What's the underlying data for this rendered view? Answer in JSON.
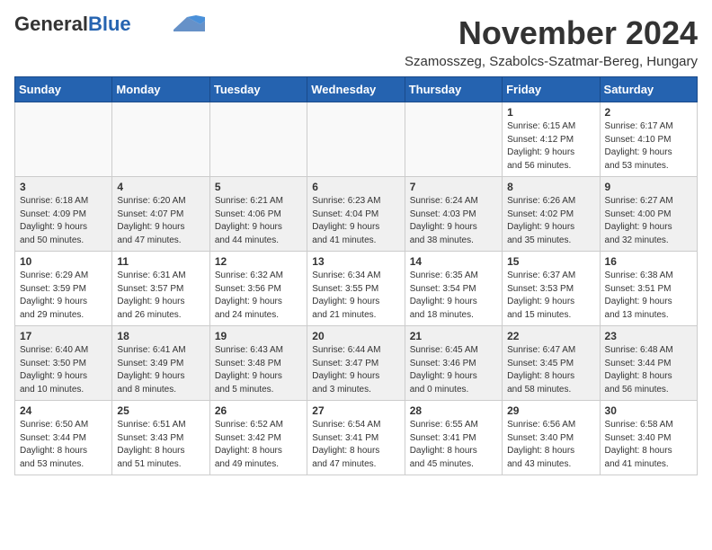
{
  "header": {
    "logo_general": "General",
    "logo_blue": "Blue",
    "month_title": "November 2024",
    "location": "Szamosszeg, Szabolcs-Szatmar-Bereg, Hungary"
  },
  "weekdays": [
    "Sunday",
    "Monday",
    "Tuesday",
    "Wednesday",
    "Thursday",
    "Friday",
    "Saturday"
  ],
  "weeks": [
    [
      {
        "day": "",
        "info": ""
      },
      {
        "day": "",
        "info": ""
      },
      {
        "day": "",
        "info": ""
      },
      {
        "day": "",
        "info": ""
      },
      {
        "day": "",
        "info": ""
      },
      {
        "day": "1",
        "info": "Sunrise: 6:15 AM\nSunset: 4:12 PM\nDaylight: 9 hours\nand 56 minutes."
      },
      {
        "day": "2",
        "info": "Sunrise: 6:17 AM\nSunset: 4:10 PM\nDaylight: 9 hours\nand 53 minutes."
      }
    ],
    [
      {
        "day": "3",
        "info": "Sunrise: 6:18 AM\nSunset: 4:09 PM\nDaylight: 9 hours\nand 50 minutes."
      },
      {
        "day": "4",
        "info": "Sunrise: 6:20 AM\nSunset: 4:07 PM\nDaylight: 9 hours\nand 47 minutes."
      },
      {
        "day": "5",
        "info": "Sunrise: 6:21 AM\nSunset: 4:06 PM\nDaylight: 9 hours\nand 44 minutes."
      },
      {
        "day": "6",
        "info": "Sunrise: 6:23 AM\nSunset: 4:04 PM\nDaylight: 9 hours\nand 41 minutes."
      },
      {
        "day": "7",
        "info": "Sunrise: 6:24 AM\nSunset: 4:03 PM\nDaylight: 9 hours\nand 38 minutes."
      },
      {
        "day": "8",
        "info": "Sunrise: 6:26 AM\nSunset: 4:02 PM\nDaylight: 9 hours\nand 35 minutes."
      },
      {
        "day": "9",
        "info": "Sunrise: 6:27 AM\nSunset: 4:00 PM\nDaylight: 9 hours\nand 32 minutes."
      }
    ],
    [
      {
        "day": "10",
        "info": "Sunrise: 6:29 AM\nSunset: 3:59 PM\nDaylight: 9 hours\nand 29 minutes."
      },
      {
        "day": "11",
        "info": "Sunrise: 6:31 AM\nSunset: 3:57 PM\nDaylight: 9 hours\nand 26 minutes."
      },
      {
        "day": "12",
        "info": "Sunrise: 6:32 AM\nSunset: 3:56 PM\nDaylight: 9 hours\nand 24 minutes."
      },
      {
        "day": "13",
        "info": "Sunrise: 6:34 AM\nSunset: 3:55 PM\nDaylight: 9 hours\nand 21 minutes."
      },
      {
        "day": "14",
        "info": "Sunrise: 6:35 AM\nSunset: 3:54 PM\nDaylight: 9 hours\nand 18 minutes."
      },
      {
        "day": "15",
        "info": "Sunrise: 6:37 AM\nSunset: 3:53 PM\nDaylight: 9 hours\nand 15 minutes."
      },
      {
        "day": "16",
        "info": "Sunrise: 6:38 AM\nSunset: 3:51 PM\nDaylight: 9 hours\nand 13 minutes."
      }
    ],
    [
      {
        "day": "17",
        "info": "Sunrise: 6:40 AM\nSunset: 3:50 PM\nDaylight: 9 hours\nand 10 minutes."
      },
      {
        "day": "18",
        "info": "Sunrise: 6:41 AM\nSunset: 3:49 PM\nDaylight: 9 hours\nand 8 minutes."
      },
      {
        "day": "19",
        "info": "Sunrise: 6:43 AM\nSunset: 3:48 PM\nDaylight: 9 hours\nand 5 minutes."
      },
      {
        "day": "20",
        "info": "Sunrise: 6:44 AM\nSunset: 3:47 PM\nDaylight: 9 hours\nand 3 minutes."
      },
      {
        "day": "21",
        "info": "Sunrise: 6:45 AM\nSunset: 3:46 PM\nDaylight: 9 hours\nand 0 minutes."
      },
      {
        "day": "22",
        "info": "Sunrise: 6:47 AM\nSunset: 3:45 PM\nDaylight: 8 hours\nand 58 minutes."
      },
      {
        "day": "23",
        "info": "Sunrise: 6:48 AM\nSunset: 3:44 PM\nDaylight: 8 hours\nand 56 minutes."
      }
    ],
    [
      {
        "day": "24",
        "info": "Sunrise: 6:50 AM\nSunset: 3:44 PM\nDaylight: 8 hours\nand 53 minutes."
      },
      {
        "day": "25",
        "info": "Sunrise: 6:51 AM\nSunset: 3:43 PM\nDaylight: 8 hours\nand 51 minutes."
      },
      {
        "day": "26",
        "info": "Sunrise: 6:52 AM\nSunset: 3:42 PM\nDaylight: 8 hours\nand 49 minutes."
      },
      {
        "day": "27",
        "info": "Sunrise: 6:54 AM\nSunset: 3:41 PM\nDaylight: 8 hours\nand 47 minutes."
      },
      {
        "day": "28",
        "info": "Sunrise: 6:55 AM\nSunset: 3:41 PM\nDaylight: 8 hours\nand 45 minutes."
      },
      {
        "day": "29",
        "info": "Sunrise: 6:56 AM\nSunset: 3:40 PM\nDaylight: 8 hours\nand 43 minutes."
      },
      {
        "day": "30",
        "info": "Sunrise: 6:58 AM\nSunset: 3:40 PM\nDaylight: 8 hours\nand 41 minutes."
      }
    ]
  ]
}
